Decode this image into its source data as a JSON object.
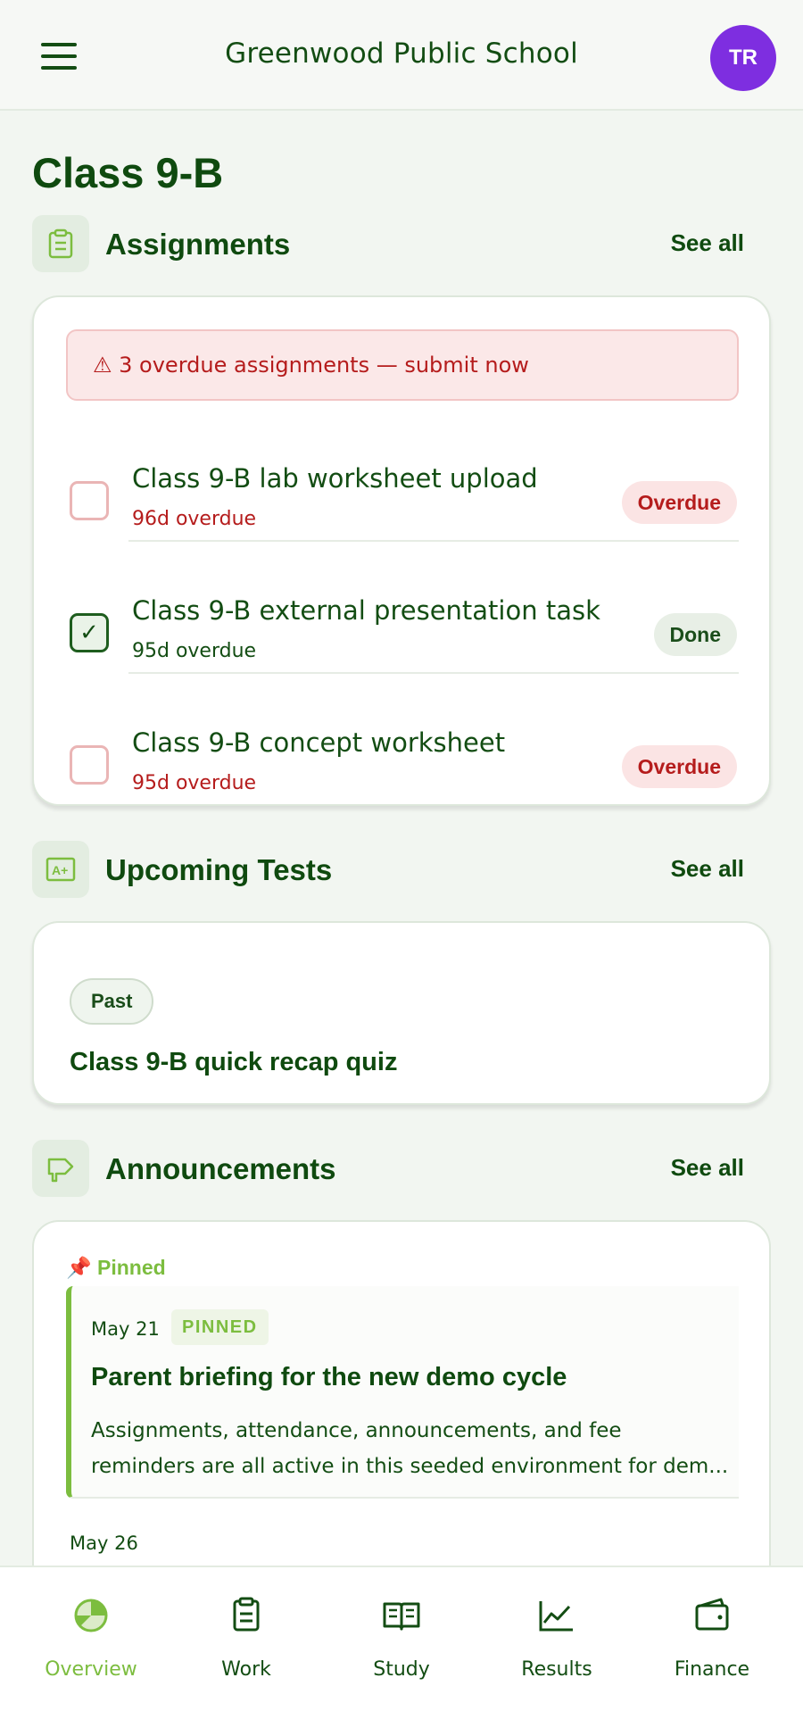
{
  "header": {
    "school_name": "Greenwood Public School",
    "avatar_initials": "TR"
  },
  "page": {
    "title": "Class 9-B"
  },
  "assignments": {
    "title": "Assignments",
    "see_all": "See all",
    "alert": "⚠ 3 overdue assignments — submit now",
    "items": [
      {
        "title": "Class 9-B lab worksheet upload",
        "sub": "96d overdue",
        "status": "Overdue",
        "checked": ""
      },
      {
        "title": "Class 9-B external presentation task",
        "sub": "95d overdue",
        "status": "Done",
        "checked": "✓"
      },
      {
        "title": "Class 9-B concept worksheet",
        "sub": "95d overdue",
        "status": "Overdue",
        "checked": ""
      }
    ]
  },
  "tests": {
    "title": "Upcoming Tests",
    "see_all": "See all",
    "items": [
      {
        "badge": "Past",
        "title": "Class 9-B quick recap quiz"
      }
    ]
  },
  "announcements": {
    "title": "Announcements",
    "see_all": "See all",
    "pinned_label": "📌 Pinned",
    "pinned": {
      "date": "May 21",
      "badge": "PINNED",
      "title": "Parent briefing for the new demo cycle",
      "body_line1": "Assignments, attendance, announcements, and fee",
      "body_line2": "reminders are all active in this seeded environment for dem..."
    },
    "next_date": "May 26"
  },
  "nav": {
    "items": [
      {
        "label": "Overview",
        "icon": "overview-icon"
      },
      {
        "label": "Work",
        "icon": "clipboard-icon"
      },
      {
        "label": "Study",
        "icon": "book-icon"
      },
      {
        "label": "Results",
        "icon": "chart-icon"
      },
      {
        "label": "Finance",
        "icon": "wallet-icon"
      }
    ],
    "active": "Overview"
  },
  "colors": {
    "primary": "#0f4a0f",
    "accent": "#7cbd3f",
    "danger": "#b51c1c",
    "avatar": "#7e2ee0",
    "background": "#f2f6f1"
  }
}
